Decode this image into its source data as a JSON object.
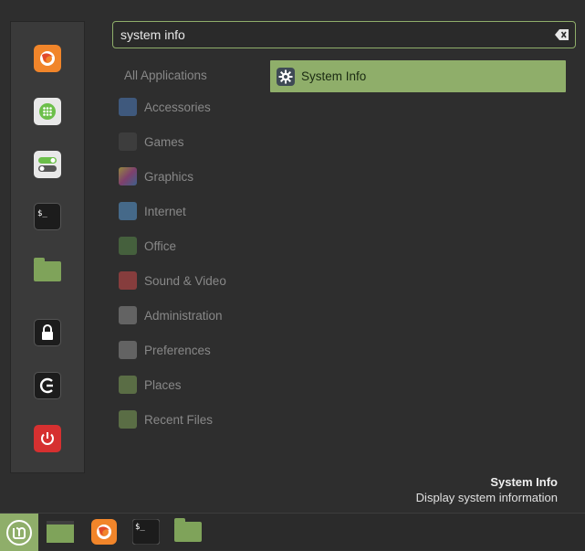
{
  "search": {
    "value": "system info",
    "placeholder": ""
  },
  "favorites": [
    {
      "name": "firefox-icon"
    },
    {
      "name": "software-manager-icon"
    },
    {
      "name": "system-settings-icon"
    },
    {
      "name": "terminal-icon"
    },
    {
      "name": "files-icon"
    },
    {
      "name": "lock-screen-icon"
    },
    {
      "name": "logout-icon"
    },
    {
      "name": "quit-icon"
    }
  ],
  "categories": {
    "all": "All Applications",
    "items": [
      {
        "label": "Accessories",
        "color": "#4f7ec0"
      },
      {
        "label": "Games",
        "color": "#5a5a5a"
      },
      {
        "label": "Graphics",
        "color": "#c04fa0"
      },
      {
        "label": "Internet",
        "color": "#5a9ad6"
      },
      {
        "label": "Office",
        "color": "#5a8a4a"
      },
      {
        "label": "Sound & Video",
        "color": "#d04a4a"
      },
      {
        "label": "Administration",
        "color": "#909090"
      },
      {
        "label": "Preferences",
        "color": "#909090"
      },
      {
        "label": "Places",
        "color": "#7fa35a"
      },
      {
        "label": "Recent Files",
        "color": "#7fa35a"
      }
    ]
  },
  "result": {
    "label": "System Info"
  },
  "description": {
    "title": "System Info",
    "text": "Display system information"
  },
  "colors": {
    "accent": "#8fae6a",
    "background": "#2e2e2e"
  }
}
